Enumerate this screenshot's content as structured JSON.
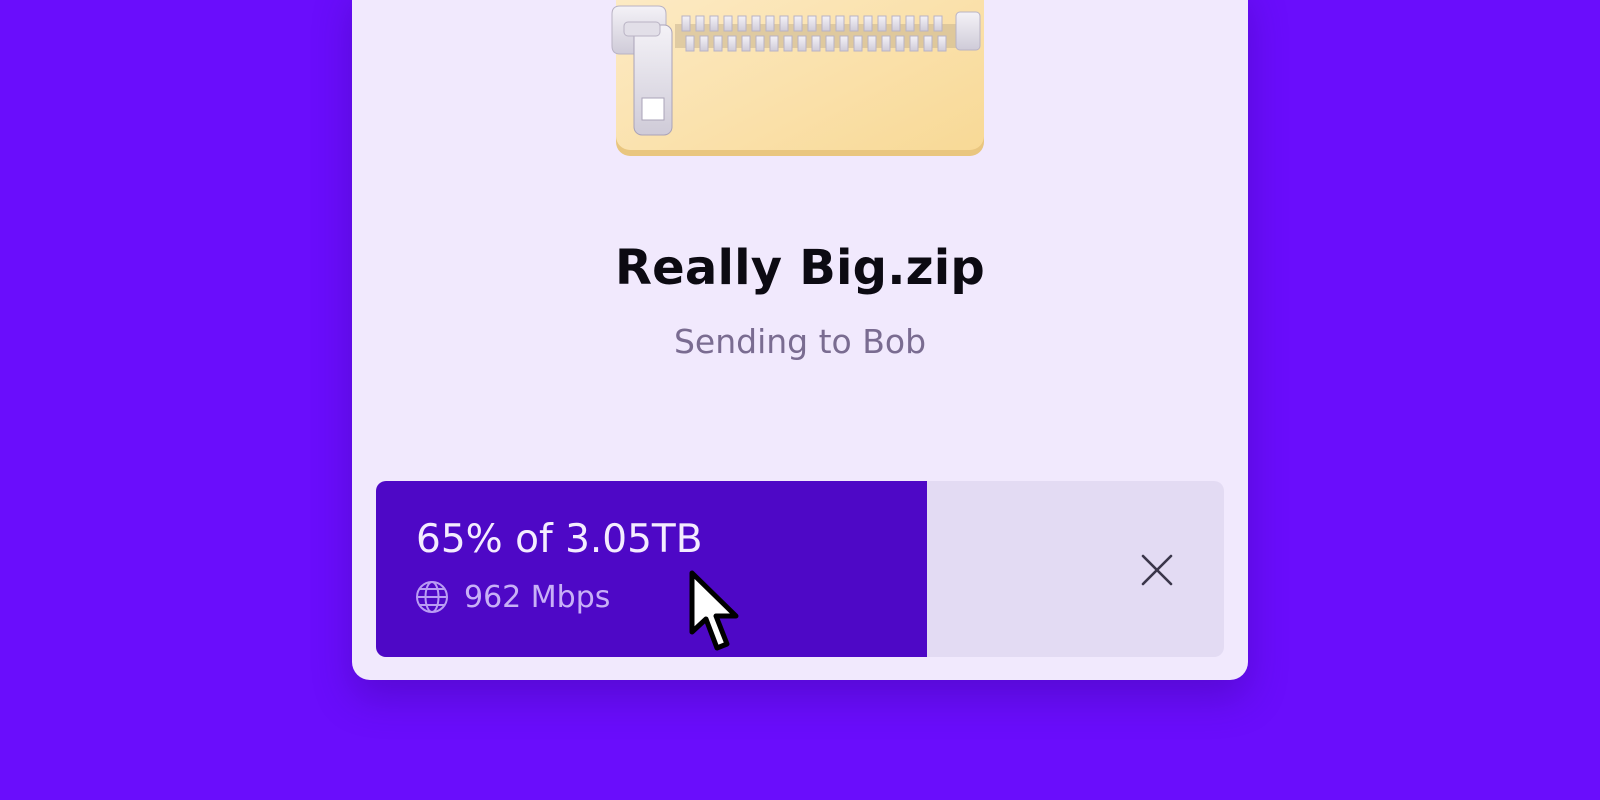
{
  "file": {
    "name": "Really Big.zip",
    "status": "Sending to Bob",
    "icon": "zip-folder-icon"
  },
  "transfer": {
    "progress_fraction": 0.65,
    "progress_text": "65% of 3.05TB",
    "speed": "962 Mbps",
    "speed_icon": "globe-icon",
    "cancel_icon": "close-icon"
  },
  "colors": {
    "background": "#6a0dfc",
    "card": "#f1e9fd",
    "progress_fill": "#4e08c6",
    "progress_track": "#e3dbf3",
    "title": "#0c0a12",
    "subtitle": "#7a6c91"
  },
  "pointer": {
    "icon": "mouse-cursor-icon"
  }
}
